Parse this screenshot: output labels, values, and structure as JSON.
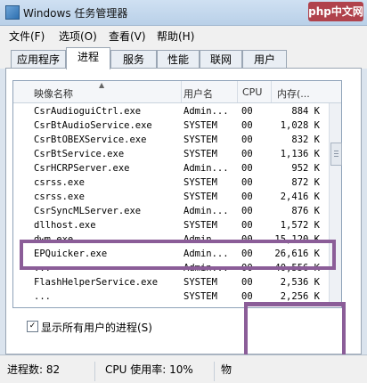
{
  "window": {
    "title": "Windows 任务管理器",
    "watermark": "php中文网"
  },
  "menu": [
    "文件(F)",
    "选项(O)",
    "查看(V)",
    "帮助(H)"
  ],
  "tabs": [
    "应用程序",
    "进程",
    "服务",
    "性能",
    "联网",
    "用户"
  ],
  "active_tab": "进程",
  "table": {
    "columns": [
      "映像名称",
      "用户名",
      "CPU",
      "内存(..."
    ],
    "rows": [
      [
        "CsrAudioguiCtrl.exe",
        "Admin...",
        "00",
        "884 K"
      ],
      [
        "CsrBtAudioService.exe",
        "SYSTEM",
        "00",
        "1,028 K"
      ],
      [
        "CsrBtOBEXService.exe",
        "SYSTEM",
        "00",
        "832 K"
      ],
      [
        "CsrBtService.exe",
        "SYSTEM",
        "00",
        "1,136 K"
      ],
      [
        "CsrHCRPServer.exe",
        "Admin...",
        "00",
        "952 K"
      ],
      [
        "csrss.exe",
        "SYSTEM",
        "00",
        "872 K"
      ],
      [
        "csrss.exe",
        "SYSTEM",
        "00",
        "2,416 K"
      ],
      [
        "CsrSyncMLServer.exe",
        "Admin...",
        "00",
        "876 K"
      ],
      [
        "dllhost.exe",
        "SYSTEM",
        "00",
        "1,572 K"
      ],
      [
        "dwm.exe",
        "Admin...",
        "00",
        "15,120 K"
      ],
      [
        "EPQuicker.exe",
        "Admin...",
        "00",
        "26,616 K"
      ],
      [
        "...",
        "Admin...",
        "00",
        "40,556 K"
      ],
      [
        "FlashHelperService.exe",
        "SYSTEM",
        "00",
        "2,536 K"
      ],
      [
        "...",
        "SYSTEM",
        "00",
        "2,256 K"
      ]
    ],
    "selected_process": "EPQuicker.exe"
  },
  "show_all_users": {
    "label": "显示所有用户的进程(S)",
    "checked_glyph": "✓"
  },
  "status": {
    "processes": "进程数: 82",
    "cpu": "CPU 使用率: 10%",
    "memory": "物"
  },
  "colors": {
    "highlight": "#8b5d98",
    "titlebar": "#c5d9ef",
    "watermark_bg": "#b0424c"
  }
}
